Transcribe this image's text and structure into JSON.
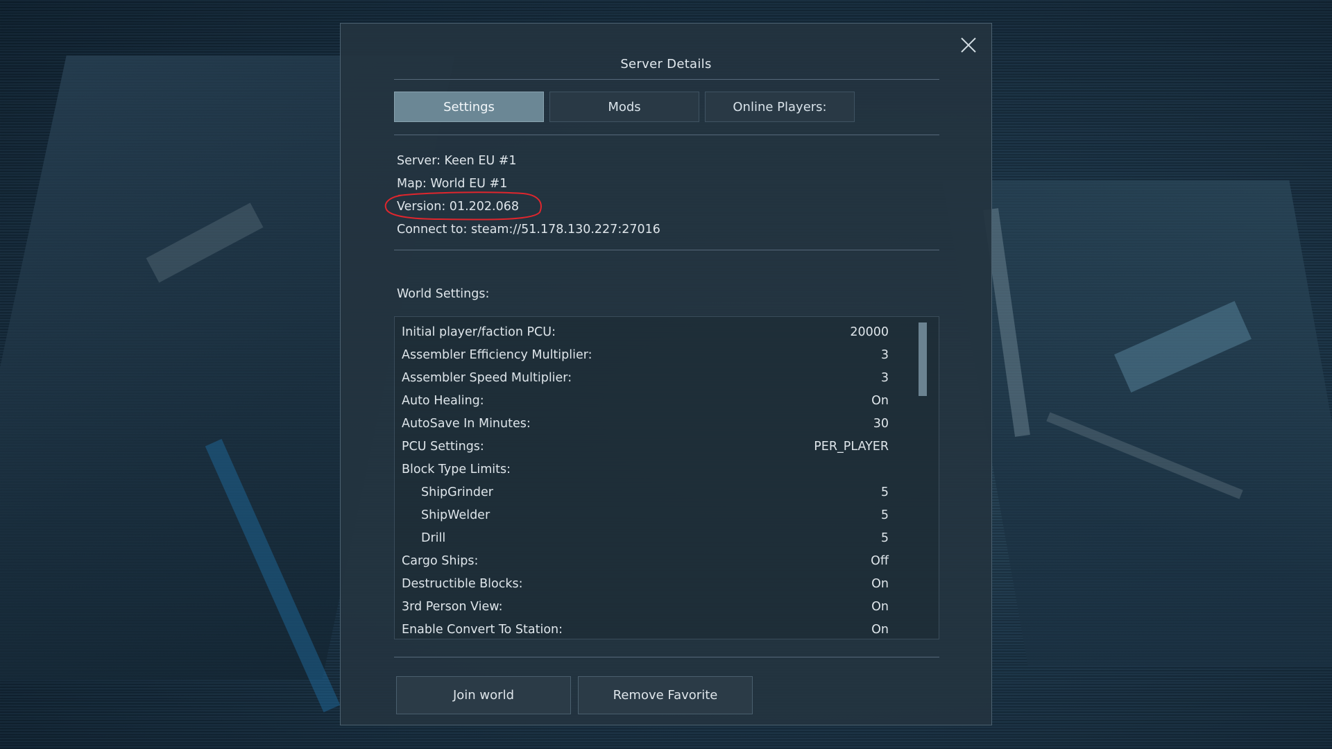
{
  "dialog": {
    "title": "Server Details",
    "close_icon": "close-icon"
  },
  "tabs": [
    {
      "label": "Settings",
      "active": true
    },
    {
      "label": "Mods",
      "active": false
    },
    {
      "label": "Online Players:",
      "active": false
    }
  ],
  "server_info": {
    "server": "Server: Keen EU #1",
    "map": "Map: World EU #1",
    "version": "Version: 01.202.068",
    "connect": "Connect to: steam://51.178.130.227:27016"
  },
  "annotation": {
    "color": "#e0262d"
  },
  "world_settings": {
    "title": "World Settings:",
    "rows": [
      {
        "label": "Initial player/faction PCU:",
        "value": "20000",
        "indent": false
      },
      {
        "label": "Assembler Efficiency Multiplier:",
        "value": "3",
        "indent": false
      },
      {
        "label": "Assembler Speed Multiplier:",
        "value": "3",
        "indent": false
      },
      {
        "label": "Auto Healing:",
        "value": "On",
        "indent": false
      },
      {
        "label": "AutoSave In Minutes:",
        "value": "30",
        "indent": false
      },
      {
        "label": "PCU Settings:",
        "value": "PER_PLAYER",
        "indent": false
      },
      {
        "label": "Block Type Limits:",
        "value": "",
        "indent": false
      },
      {
        "label": "ShipGrinder",
        "value": "5",
        "indent": true
      },
      {
        "label": "ShipWelder",
        "value": "5",
        "indent": true
      },
      {
        "label": "Drill",
        "value": "5",
        "indent": true
      },
      {
        "label": "Cargo Ships:",
        "value": "Off",
        "indent": false
      },
      {
        "label": "Destructible Blocks:",
        "value": "On",
        "indent": false
      },
      {
        "label": "3rd Person View:",
        "value": "On",
        "indent": false
      },
      {
        "label": "Enable Convert To Station:",
        "value": "On",
        "indent": false
      }
    ]
  },
  "actions": {
    "join": "Join world",
    "remove_favorite": "Remove Favorite"
  }
}
